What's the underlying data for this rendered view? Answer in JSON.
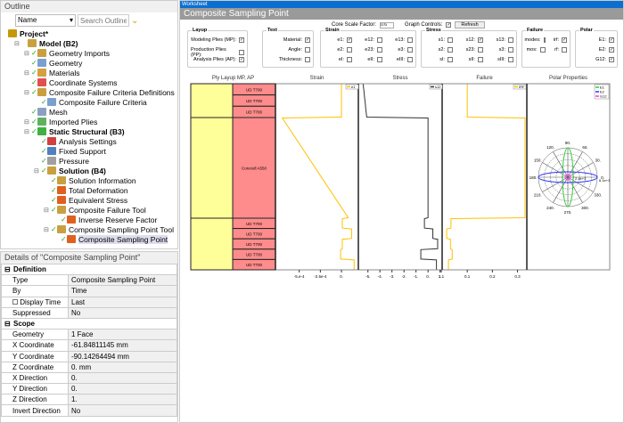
{
  "outline": {
    "title": "Outline",
    "filter_select": "Name",
    "search_placeholder": "Search Outline",
    "items": [
      {
        "label": "Project*",
        "level": 0,
        "bold": true,
        "color": "#c8960a"
      },
      {
        "label": "Model (B2)",
        "level": 1,
        "bold": true,
        "color": "#c8a040"
      },
      {
        "label": "Geometry Imports",
        "level": 2,
        "color": "#c8a040"
      },
      {
        "label": "Geometry",
        "level": 2,
        "color": "#7aa0d0"
      },
      {
        "label": "Materials",
        "level": 2,
        "color": "#d4a040"
      },
      {
        "label": "Coordinate Systems",
        "level": 2,
        "color": "#e05050"
      },
      {
        "label": "Composite Failure Criteria Definitions",
        "level": 2,
        "color": "#c8a040"
      },
      {
        "label": "Composite Failure Criteria",
        "level": 3,
        "color": "#7aa0d0"
      },
      {
        "label": "Mesh",
        "level": 2,
        "color": "#8aa0c0"
      },
      {
        "label": "Imported Plies",
        "level": 2,
        "color": "#60b060"
      },
      {
        "label": "Static Structural (B3)",
        "level": 2,
        "bold": true,
        "color": "#40b040"
      },
      {
        "label": "Analysis Settings",
        "level": 3,
        "color": "#d04040"
      },
      {
        "label": "Fixed Support",
        "level": 3,
        "color": "#5080c0"
      },
      {
        "label": "Pressure",
        "level": 3,
        "color": "#a0a0a0"
      },
      {
        "label": "Solution (B4)",
        "level": 3,
        "bold": true,
        "color": "#c8a040"
      },
      {
        "label": "Solution Information",
        "level": 4,
        "color": "#c8a040"
      },
      {
        "label": "Total Deformation",
        "level": 4,
        "color": "#e06020"
      },
      {
        "label": "Equivalent Stress",
        "level": 4,
        "color": "#e06020"
      },
      {
        "label": "Composite Failure Tool",
        "level": 4,
        "color": "#c8a040"
      },
      {
        "label": "Inverse Reserve Factor",
        "level": 5,
        "color": "#e06020"
      },
      {
        "label": "Composite Sampling Point Tool",
        "level": 4,
        "color": "#c8a040"
      },
      {
        "label": "Composite Sampling Point",
        "level": 5,
        "color": "#e06020",
        "selected": true
      }
    ]
  },
  "details": {
    "title": "Details of \"Composite Sampling Point\"",
    "rows": [
      {
        "group": "Definition"
      },
      {
        "k": "Type",
        "v": "Composite Sampling Point"
      },
      {
        "k": "By",
        "v": "Time"
      },
      {
        "k": "Display Time",
        "v": "Last"
      },
      {
        "k": "Suppressed",
        "v": "No"
      },
      {
        "group": "Scope"
      },
      {
        "k": "Geometry",
        "v": "1 Face"
      },
      {
        "k": "X Coordinate",
        "v": "-61.84811145 mm"
      },
      {
        "k": "Y Coordinate",
        "v": "-90.14264494 mm"
      },
      {
        "k": "Z Coordinate",
        "v": "0. mm"
      },
      {
        "k": "X Direction",
        "v": "0."
      },
      {
        "k": "Y Direction",
        "v": "0."
      },
      {
        "k": "Z Direction",
        "v": "1."
      },
      {
        "k": "Invert Direction",
        "v": "No"
      }
    ]
  },
  "worksheet": {
    "tab": "Worksheet",
    "title": "Composite Sampling Point",
    "core_scale_label": "Core Scale Factor:",
    "core_scale_value": "0.6",
    "graph_controls_label": "Graph Controls:",
    "graph_controls": true,
    "refresh": "Refresh",
    "groups": [
      {
        "legend": "Layup",
        "items": [
          {
            "l": "Modeling Plies (MP):",
            "c": true
          },
          {
            "l": "Production Plies (PP):",
            "c": false
          },
          {
            "l": "Analysis Plies (AP):",
            "c": true
          }
        ]
      },
      {
        "legend": "Text",
        "items": [
          {
            "l": "Material:",
            "c": true
          },
          {
            "l": "Angle:",
            "c": false
          },
          {
            "l": "Thickness:",
            "c": false
          }
        ]
      },
      {
        "legend": "Strain",
        "items": [
          {
            "l": "e1:",
            "c": true
          },
          {
            "l": "e12:",
            "c": false
          },
          {
            "l": "e13:",
            "c": false
          },
          {
            "l": "e2:",
            "c": false
          },
          {
            "l": "e23:",
            "c": false
          },
          {
            "l": "e3:",
            "c": false
          },
          {
            "l": "eI:",
            "c": false
          },
          {
            "l": "eII:",
            "c": false
          },
          {
            "l": "eIII:",
            "c": false
          }
        ]
      },
      {
        "legend": "Stress",
        "items": [
          {
            "l": "s1:",
            "c": false
          },
          {
            "l": "s12:",
            "c": true
          },
          {
            "l": "s13:",
            "c": false
          },
          {
            "l": "s2:",
            "c": false
          },
          {
            "l": "s23:",
            "c": false
          },
          {
            "l": "s3:",
            "c": false
          },
          {
            "l": "sI:",
            "c": false
          },
          {
            "l": "sII:",
            "c": false
          },
          {
            "l": "sIII:",
            "c": false
          }
        ]
      },
      {
        "legend": "Failure",
        "items": [
          {
            "l": "modes:",
            "c": false
          },
          {
            "l": "irf:",
            "c": true
          },
          {
            "l": "mos:",
            "c": false
          },
          {
            "l": "rf:",
            "c": false
          }
        ]
      },
      {
        "legend": "Polar",
        "items": [
          {
            "l": "E1:",
            "c": true
          },
          {
            "l": "E2:",
            "c": true
          },
          {
            "l": "G12:",
            "c": true
          }
        ]
      }
    ]
  },
  "chart_data": {
    "type": "line",
    "titles": [
      "Ply Layup MP, AP",
      "Strain",
      "Stress",
      "Failure",
      "Polar Properties"
    ],
    "plies": [
      "UD T700",
      "UD T700",
      "UD T700",
      "Corecell A550",
      "UD T700",
      "UD T700",
      "UD T700",
      "UD T700",
      "UD T700"
    ],
    "strain": {
      "legend": "e1",
      "color": "#ffc000",
      "xlim": [
        -0.00075,
        0.0002
      ],
      "ticks": [
        -0.0005,
        -0.00025,
        0
      ],
      "tick_labels": [
        "-5.e-4",
        "-2.5e-4",
        "0."
      ],
      "per_ply": [
        [
          0,
          0
        ],
        [
          0,
          0
        ],
        [
          0,
          0
        ],
        [
          -0.0007,
          8e-05
        ],
        [
          1e-05,
          1e-05
        ],
        [
          0.00012,
          0.00012
        ],
        [
          1e-05,
          1e-05
        ],
        [
          -1e-05,
          -1e-05
        ],
        [
          0.00015,
          0.00015
        ]
      ]
    },
    "stress": {
      "legend": "s12",
      "color": "#333333",
      "xlim": [
        -5.5,
        1.1
      ],
      "ticks": [
        -5,
        -4,
        -3,
        -2,
        -1,
        0,
        1,
        1.1
      ],
      "tick_labels": [
        "-5.",
        "-4.",
        "-3.",
        "-2.",
        "-1.",
        "0.",
        "1.",
        "1.1"
      ],
      "per_ply": [
        [
          -5.4,
          -5.3
        ],
        [
          -5.3,
          -5.2
        ],
        [
          -5.2,
          -5.1
        ],
        [
          0,
          0
        ],
        [
          -0.3,
          -0.3
        ],
        [
          0.4,
          0.4
        ],
        [
          0.8,
          0.8
        ],
        [
          -0.6,
          -0.6
        ],
        [
          0.7,
          0.7
        ]
      ]
    },
    "failure": {
      "legend": "IRF",
      "color": "#ffc000",
      "xlim": [
        0,
        0.33
      ],
      "ticks": [
        0.1,
        0.2,
        0.3
      ],
      "tick_labels": [
        "0.1",
        "0.2",
        "0.3"
      ],
      "per_ply": [
        [
          0.1,
          0.1
        ],
        [
          0.1,
          0.1
        ],
        [
          0.1,
          0.1
        ],
        [
          0.33,
          0.33
        ],
        [
          0.035,
          0.035
        ],
        [
          0.018,
          0.018
        ],
        [
          0.033,
          0.033
        ],
        [
          0.04,
          0.04
        ],
        [
          0.025,
          0.025
        ]
      ]
    },
    "polar": {
      "series": [
        {
          "name": "E1",
          "color": "#33cc33"
        },
        {
          "name": "E2",
          "color": "#3333ff"
        },
        {
          "name": "G12",
          "color": "#ff33ff"
        }
      ],
      "angle_labels": [
        "0.",
        "30.",
        "60.",
        "90.",
        "120.",
        "150.",
        "180.",
        "210.",
        "240.",
        "270.",
        "300.",
        "330."
      ],
      "radial_labels": [
        "2.4e+3",
        "6.1e+3"
      ]
    }
  }
}
